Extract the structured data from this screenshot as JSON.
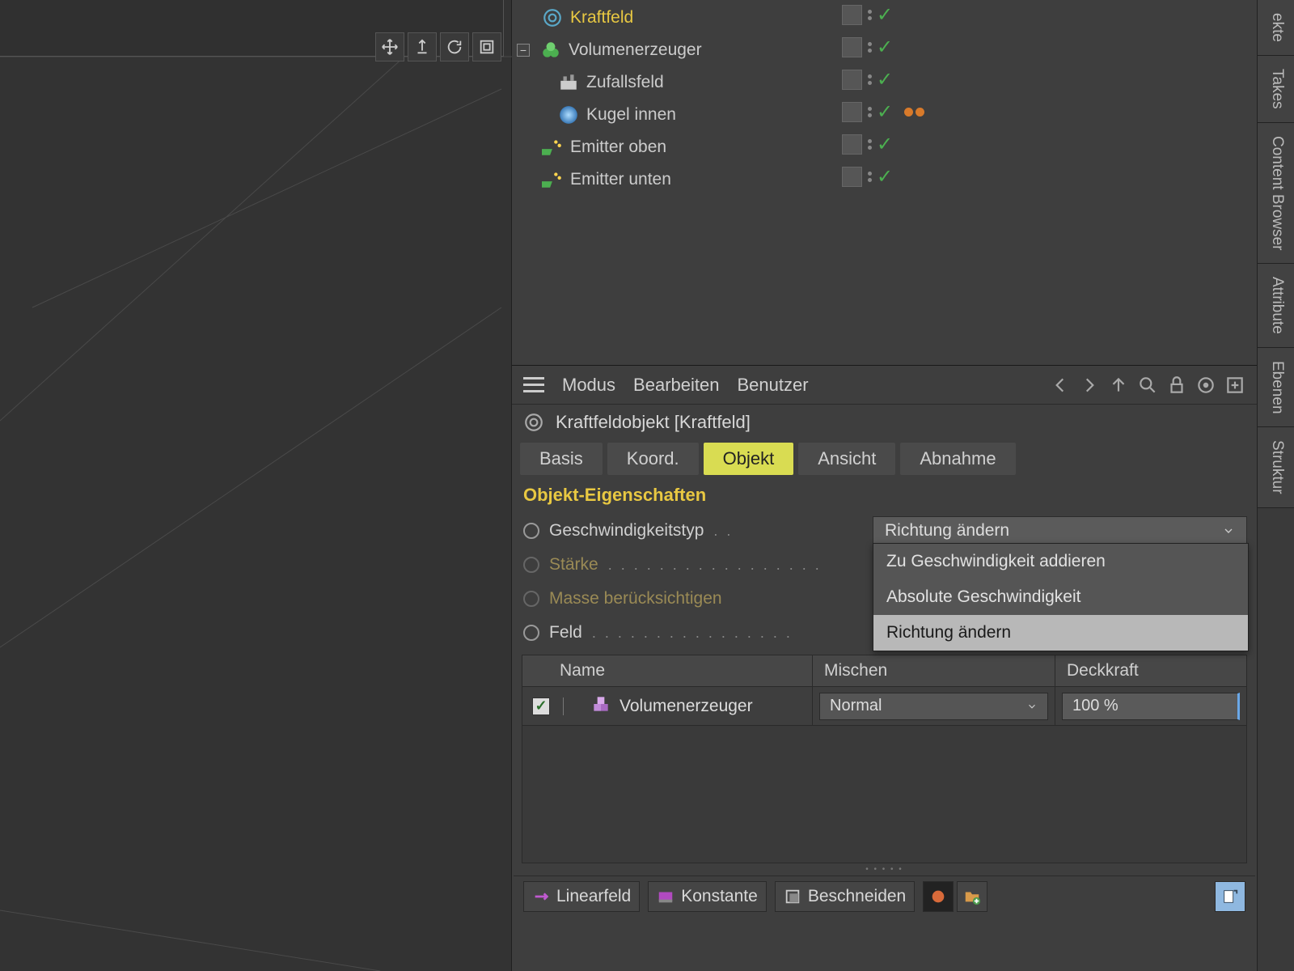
{
  "objectManager": {
    "items": [
      {
        "name": "Kraftfeld",
        "highlight": true
      },
      {
        "name": "Volumenerzeuger"
      },
      {
        "name": "Zufallsfeld"
      },
      {
        "name": "Kugel innen"
      },
      {
        "name": "Emitter oben"
      },
      {
        "name": "Emitter unten"
      }
    ]
  },
  "attrMenus": {
    "mode": "Modus",
    "edit": "Bearbeiten",
    "user": "Benutzer"
  },
  "objHeader": "Kraftfeldobjekt [Kraftfeld]",
  "tabs": {
    "basis": "Basis",
    "koord": "Koord.",
    "objekt": "Objekt",
    "ansicht": "Ansicht",
    "abnahme": "Abnahme"
  },
  "sectionTitle": "Objekt-Eigenschaften",
  "props": {
    "velType": "Geschwindigkeitstyp",
    "velTypeValue": "Richtung ändern",
    "velOptions": [
      "Zu Geschwindigkeit addieren",
      "Absolute Geschwindigkeit",
      "Richtung ändern"
    ],
    "strength": "Stärke",
    "mass": "Masse berücksichtigen",
    "field": "Feld"
  },
  "fieldTable": {
    "headers": {
      "name": "Name",
      "mix": "Mischen",
      "opacity": "Deckkraft"
    },
    "row": {
      "name": "Volumenerzeuger",
      "mix": "Normal",
      "opacity": "100 %"
    }
  },
  "bottomBar": {
    "linear": "Linearfeld",
    "constant": "Konstante",
    "clip": "Beschneiden"
  },
  "sideTabs": [
    "ekte",
    "Takes",
    "Content Browser",
    "Attribute",
    "Ebenen",
    "Struktur"
  ]
}
